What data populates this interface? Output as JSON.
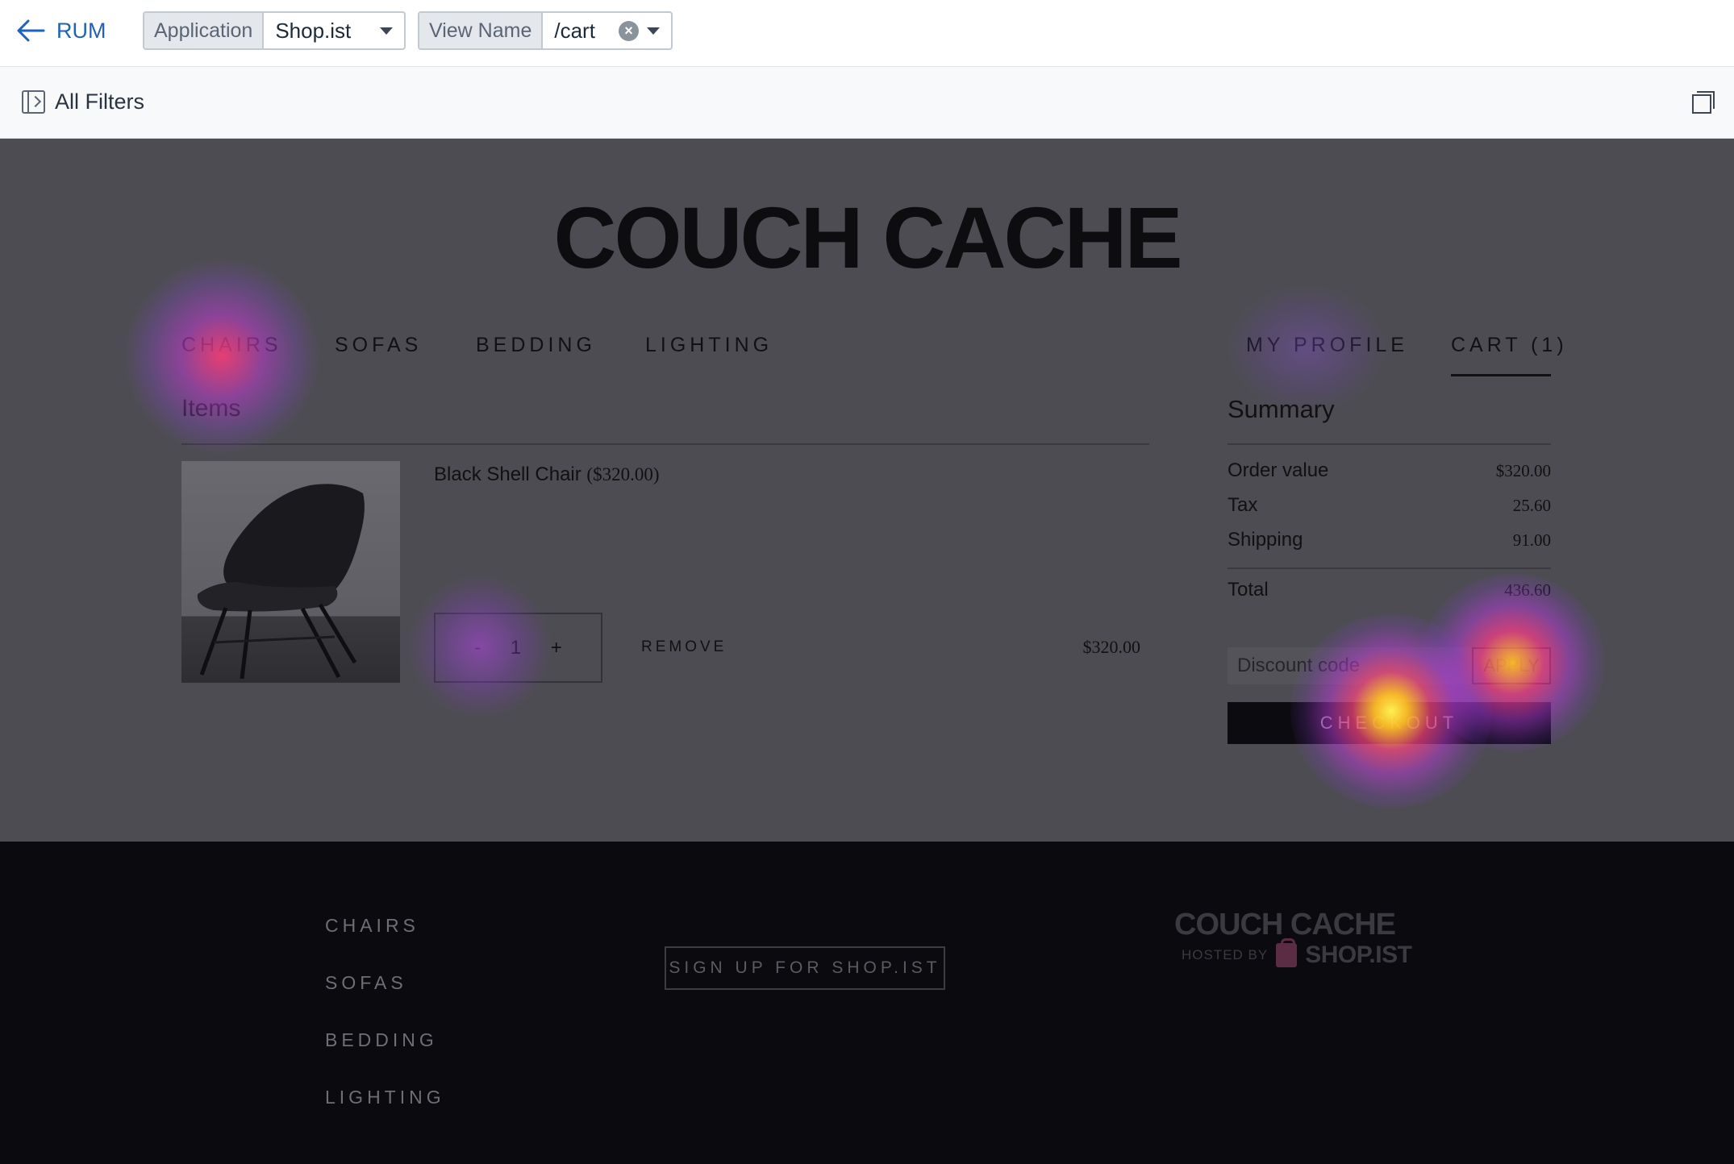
{
  "toolbar": {
    "back_label": "RUM",
    "application": {
      "label": "Application",
      "value": "Shop.ist"
    },
    "view_name": {
      "label": "View Name",
      "value": "/cart"
    }
  },
  "filters": {
    "all_filters_label": "All Filters"
  },
  "shop": {
    "brand": "COUCH CACHE",
    "nav_left": [
      "CHAIRS",
      "SOFAS",
      "BEDDING",
      "LIGHTING"
    ],
    "nav_right": [
      "MY PROFILE",
      "CART (1)"
    ],
    "items_title": "Items",
    "item": {
      "name": "Black Shell Chair",
      "price_paren": "($320.00)",
      "qty_minus": "-",
      "qty_value": "1",
      "qty_plus": "+",
      "remove_label": "REMOVE",
      "line_total": "$320.00"
    },
    "summary": {
      "title": "Summary",
      "rows": [
        {
          "label": "Order value",
          "value": "$320.00"
        },
        {
          "label": "Tax",
          "value": "25.60"
        },
        {
          "label": "Shipping",
          "value": "91.00"
        }
      ],
      "total_label": "Total",
      "total_value": "436.60",
      "discount_placeholder": "Discount code",
      "apply_label": "APPLY",
      "checkout_label": "CHECKOUT"
    }
  },
  "footer": {
    "links": [
      "CHAIRS",
      "SOFAS",
      "BEDDING",
      "LIGHTING"
    ],
    "signup_label": "SIGN UP FOR SHOP.IST",
    "brand": "COUCH CACHE",
    "hosted_by": "HOSTED BY",
    "host_name": "SHOP.IST"
  },
  "colors": {
    "rum_link": "#1e63b8",
    "overlay": "#4d4c52",
    "footer_bg": "#0b0a0f",
    "heat_low": "#8a4fd6",
    "heat_mid": "#ff2f87",
    "heat_high": "#ffd23a"
  }
}
